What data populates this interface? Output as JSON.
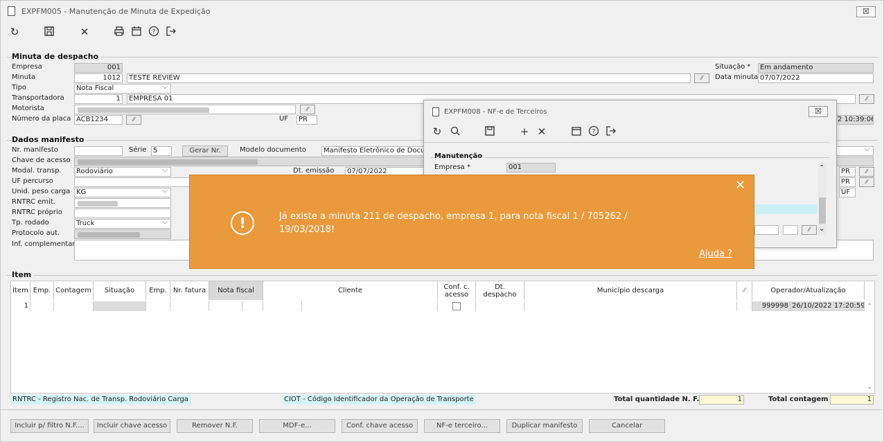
{
  "main_window": {
    "title": "EXPFM005 - Manutenção de Minuta de Expedição",
    "close_label": "☒"
  },
  "toolbar": {
    "refresh_icon": "↻",
    "save_icon": "🖫",
    "cancel_icon": "✕",
    "print_icon": "⎙",
    "calendar_icon": "📅",
    "help_icon": "?",
    "exit_icon": "↦"
  },
  "minuta": {
    "section_title": "Minuta de despacho",
    "empresa_label": "Empresa",
    "empresa_value": "001",
    "minuta_label": "Minuta",
    "minuta_value": "1012",
    "minuta_desc": "TESTE REVIEW",
    "tipo_label": "Tipo",
    "tipo_value": "Nota Fiscal",
    "transportadora_label": "Transportadora",
    "transportadora_value": "1",
    "transportadora_name": "EMPRESA 01",
    "motorista_label": "Motorista",
    "placa_label": "Número da placa",
    "placa_value": "ACB1234",
    "uf_label": "UF",
    "uf_value": "PR",
    "situacao_label": "Situação *",
    "situacao_value": "Em andamento",
    "data_label": "Data minuta",
    "data_value": "07/07/2022",
    "timestamp_partial": "2 10:39:06"
  },
  "manifesto": {
    "section_title": "Dados manifesto",
    "nr_label": "Nr. manifesto",
    "serie_label": "Série",
    "serie_value": "5",
    "gerar_label": "Gerar Nr.",
    "modelo_label": "Modelo documento",
    "modelo_value": "Manifesto Eletrônico de Docum",
    "chave_label": "Chave de acesso",
    "modal_label": "Modal. transp.",
    "modal_value": "Rodoviário",
    "emissao_label": "Dt. emissão",
    "emissao_value": "07/07/2022",
    "uf_percurso_label": "UF percurso",
    "unid_label": "Unid. peso carga",
    "unid_value": "KG",
    "rntrc_emit_label": "RNTRC emit.",
    "rntrc_proprio_label": "RNTRC próprio",
    "rodado_label": "Tp. rodado",
    "rodado_value": "Truck",
    "protocolo_label": "Protocolo aut.",
    "inf_label": "Inf. complementar",
    "uf_right1": "PR",
    "uf_right2": "PR",
    "uf_right3": "UF"
  },
  "item": {
    "section_title": "Item",
    "headers": [
      "Item",
      "Emp.",
      "Contagem",
      "Situação",
      "Emp.",
      "Nr. fatura",
      "Nota fiscal",
      "Cliente",
      "Conf. c. acesso",
      "Dt. despacho",
      "Município descarga",
      "",
      "Operador/Atualização"
    ],
    "row": {
      "item": "1",
      "operador": "999998",
      "atualizacao": "26/10/2022 17:20:59"
    }
  },
  "footer": {
    "rntrc_note": "RNTRC - Registro Nac. de Transp. Rodoviário Carga",
    "ciot_note": "CIOT - Código Identificador da Operação de Transporte",
    "total_nf_label": "Total quantidade N. F.",
    "total_nf_value": "1",
    "total_contagem_label": "Total contagem",
    "total_contagem_value": "1"
  },
  "buttons": [
    "Incluir p/ filtro N.F....",
    "Incluir chave acesso",
    "Remover N.F.",
    "MDF-e...",
    "Conf. chave acesso",
    "NF-e terceiro...",
    "Duplicar manifesto",
    "Cancelar"
  ],
  "sub_window": {
    "title": "EXPFM008 - NF-e de Terceiros",
    "close_label": "☒",
    "section_title": "Manutenção",
    "empresa_label": "Empresa *",
    "empresa_value": "001"
  },
  "toast": {
    "message_line1": "Já existe a minuta 211 de despacho, empresa 1, para nota fiscal 1 / 705262 /",
    "message_line2": "19/03/2018!",
    "help_link": "Ajuda ?",
    "close_icon": "✕",
    "alert_icon": "!"
  },
  "colors": {
    "toast_bg": "#ea9a3c",
    "note_bg": "#d4f4f7",
    "total_bg": "#fff8d6"
  }
}
